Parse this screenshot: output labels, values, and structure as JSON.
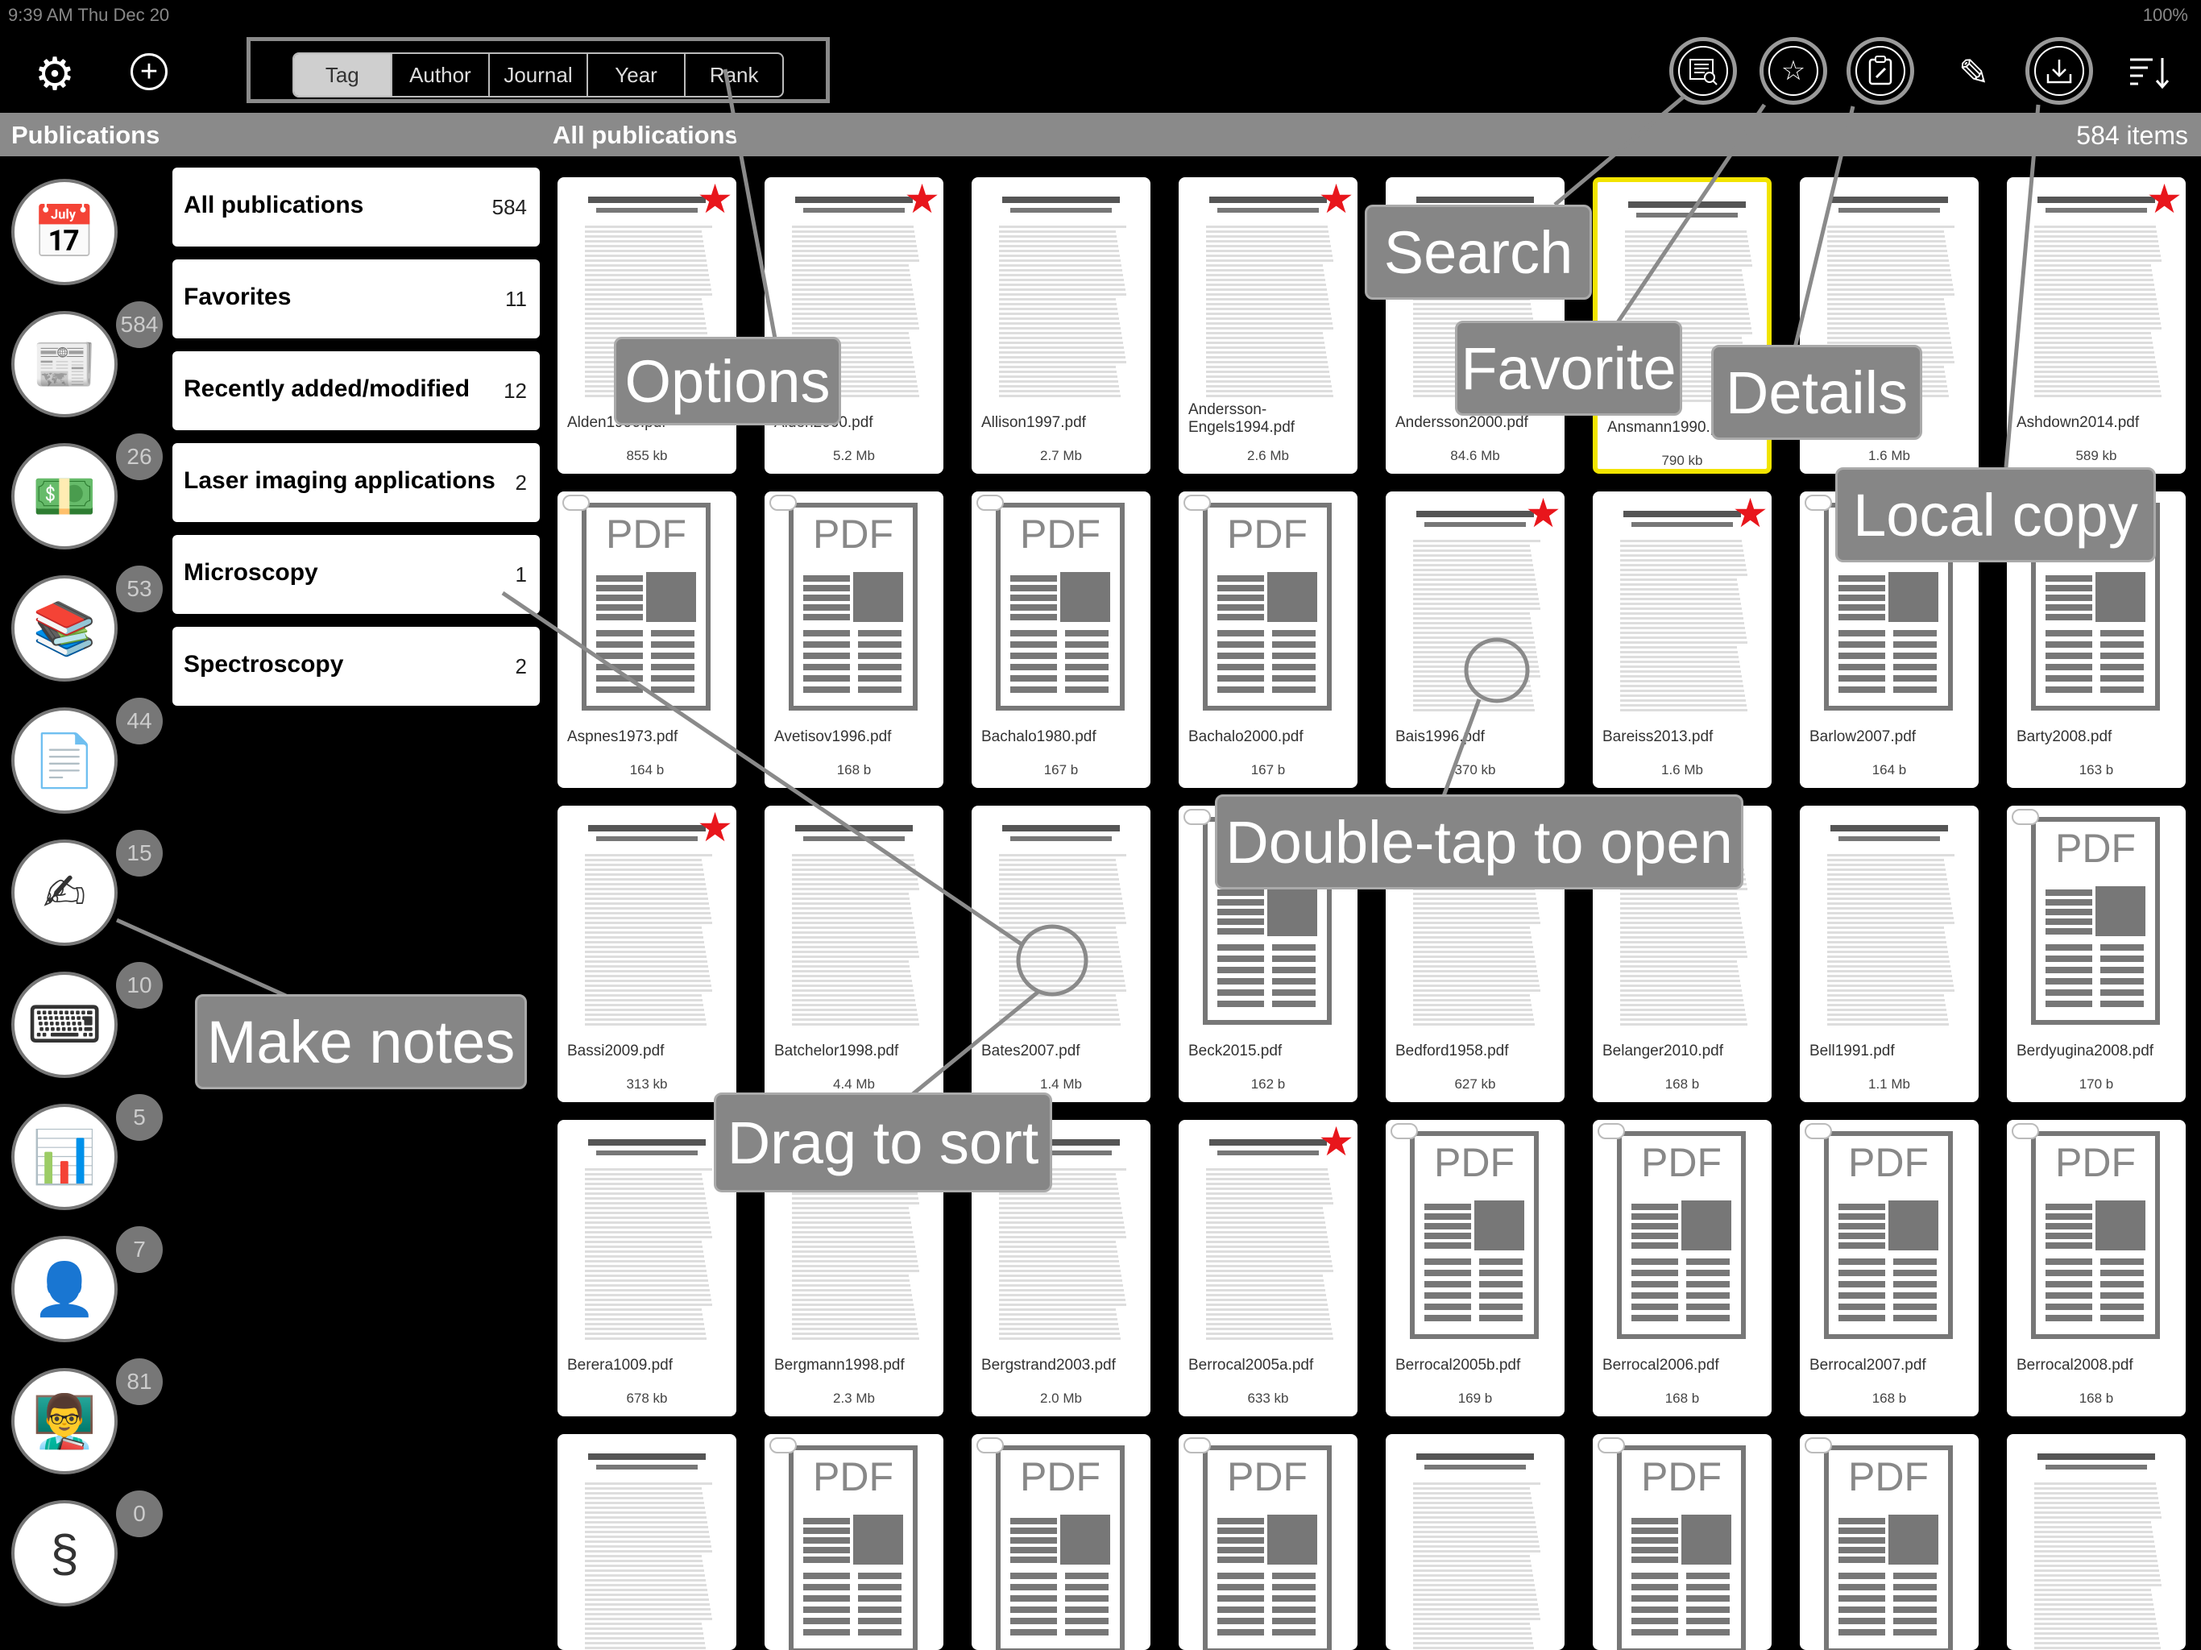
{
  "status": {
    "time": "9:39 AM   Thu Dec 20",
    "battery": "100%"
  },
  "toolbar": {
    "segments": [
      "Tag",
      "Author",
      "Journal",
      "Year",
      "Rank"
    ],
    "active_segment": "Tag",
    "icons": {
      "settings": "gear-icon",
      "add": "plus-icon",
      "search": "search-icon",
      "favorite": "star-icon",
      "details": "details-icon",
      "edit": "pencil-icon",
      "download": "download-icon",
      "sort": "sort-icon"
    }
  },
  "left_header": "Publications",
  "right_header": {
    "title": "All publications",
    "count": "584 items"
  },
  "categories": [
    {
      "icon": "calendar-icon",
      "badge": ""
    },
    {
      "icon": "publications-icon",
      "badge": "584"
    },
    {
      "icon": "wallet-icon",
      "badge": "26"
    },
    {
      "icon": "books-icon",
      "badge": "53"
    },
    {
      "icon": "invoice-icon",
      "badge": "44"
    },
    {
      "icon": "notepad-pen-icon",
      "badge": "15"
    },
    {
      "icon": "typewriter-icon",
      "badge": "10"
    },
    {
      "icon": "presentation-icon",
      "badge": "5"
    },
    {
      "icon": "organization-icon",
      "badge": "7"
    },
    {
      "icon": "teacher-icon",
      "badge": "81"
    },
    {
      "icon": "legal-document-icon",
      "badge": "0"
    }
  ],
  "tags": [
    {
      "name": "All publications",
      "count": "584"
    },
    {
      "name": "Favorites",
      "count": "11"
    },
    {
      "name": "Recently added/modified",
      "count": "12"
    },
    {
      "name": "Laser imaging applications",
      "count": "2"
    },
    {
      "name": "Microscopy",
      "count": "1"
    },
    {
      "name": "Spectroscopy",
      "count": "2"
    }
  ],
  "files": [
    {
      "name": "Alden1996.pdf",
      "size": "855 kb"
    },
    {
      "name": "Alden2000.pdf",
      "size": "5.2 Mb"
    },
    {
      "name": "Allison1997.pdf",
      "size": "2.7 Mb"
    },
    {
      "name": "Andersson-Engels1994.pdf",
      "size": "2.6 Mb"
    },
    {
      "name": "Andersson2000.pdf",
      "size": "84.6 Mb"
    },
    {
      "name": "Ansmann1990.pdf",
      "size": "790 kb"
    },
    {
      "name": "Arnold2001.pdf",
      "size": "1.6 Mb"
    },
    {
      "name": "Ashdown2014.pdf",
      "size": "589 kb"
    },
    {
      "name": "Aspnes1973.pdf",
      "size": "164 b"
    },
    {
      "name": "Avetisov1996.pdf",
      "size": "168 b"
    },
    {
      "name": "Bachalo1980.pdf",
      "size": "167 b"
    },
    {
      "name": "Bachalo2000.pdf",
      "size": "167 b"
    },
    {
      "name": "Bais1996.pdf",
      "size": "370 kb"
    },
    {
      "name": "Bareiss2013.pdf",
      "size": "1.6 Mb"
    },
    {
      "name": "Barlow2007.pdf",
      "size": "164 b"
    },
    {
      "name": "Barty2008.pdf",
      "size": "163 b"
    },
    {
      "name": "Bassi2009.pdf",
      "size": "313 kb"
    },
    {
      "name": "Batchelor1998.pdf",
      "size": "4.4 Mb"
    },
    {
      "name": "Bates2007.pdf",
      "size": "1.4 Mb"
    },
    {
      "name": "Beck2015.pdf",
      "size": "162 b"
    },
    {
      "name": "Bedford1958.pdf",
      "size": "627 kb"
    },
    {
      "name": "Belanger2010.pdf",
      "size": "168 b"
    },
    {
      "name": "Bell1991.pdf",
      "size": "1.1 Mb"
    },
    {
      "name": "Berdyugina2008.pdf",
      "size": "170 b"
    },
    {
      "name": "Berera1009.pdf",
      "size": "678 kb"
    },
    {
      "name": "Bergmann1998.pdf",
      "size": "2.3 Mb"
    },
    {
      "name": "Bergstrand2003.pdf",
      "size": "2.0 Mb"
    },
    {
      "name": "Berrocal2005a.pdf",
      "size": "633 kb"
    },
    {
      "name": "Berrocal2005b.pdf",
      "size": "169 b"
    },
    {
      "name": "Berrocal2006.pdf",
      "size": "168 b"
    },
    {
      "name": "Berrocal2007.pdf",
      "size": "168 b"
    },
    {
      "name": "Berrocal2008.pdf",
      "size": "168 b"
    },
    {
      "name": "",
      "size": ""
    },
    {
      "name": "",
      "size": ""
    },
    {
      "name": "",
      "size": ""
    },
    {
      "name": "",
      "size": ""
    },
    {
      "name": "",
      "size": ""
    },
    {
      "name": "",
      "size": ""
    },
    {
      "name": "",
      "size": ""
    },
    {
      "name": "",
      "size": ""
    }
  ],
  "callouts": {
    "options": "Options",
    "search": "Search",
    "favorite": "Favorite",
    "details": "Details",
    "local_copy": "Local copy",
    "double_tap": "Double-tap to open",
    "make_notes": "Make notes",
    "drag": "Drag to sort"
  }
}
